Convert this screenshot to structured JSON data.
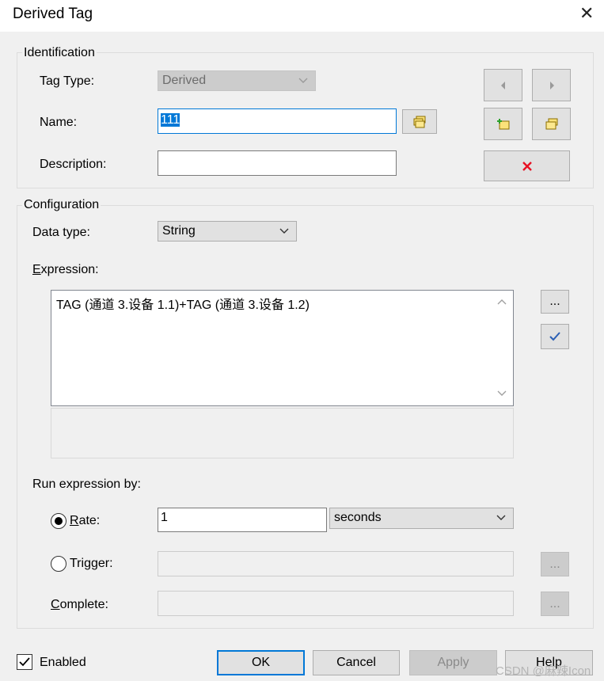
{
  "window": {
    "title": "Derived Tag",
    "close_glyph": "✕"
  },
  "identification": {
    "legend": "Identification",
    "tag_type_label": "Tag Type:",
    "tag_type_value": "Derived",
    "name_label": "Name:",
    "name_value": "111",
    "description_label": "Description:",
    "description_value": ""
  },
  "configuration": {
    "legend": "Configuration",
    "data_type_label": "Data type:",
    "data_type_value": "String",
    "expression_label_first": "E",
    "expression_label_rest": "xpression:",
    "expression_value": "TAG (通道 3.设备 1.1)+TAG (通道 3.设备 1.2)",
    "browse_button": "...",
    "run_by_label": "Run expression by:",
    "rate_label_first": "R",
    "rate_label_rest": "ate:",
    "rate_value": "1",
    "rate_unit": "seconds",
    "trigger_label": "Trigger:",
    "trigger_value": "",
    "complete_label_first": "C",
    "complete_label_rest": "omplete:",
    "complete_value": ""
  },
  "footer": {
    "enabled_label": "Enabled",
    "ok": "OK",
    "cancel": "Cancel",
    "apply": "Apply",
    "help": "Help",
    "watermark": "CSDN @麻辣Icon"
  },
  "colors": {
    "accent": "#0078d7",
    "delete_red": "#e81123"
  }
}
